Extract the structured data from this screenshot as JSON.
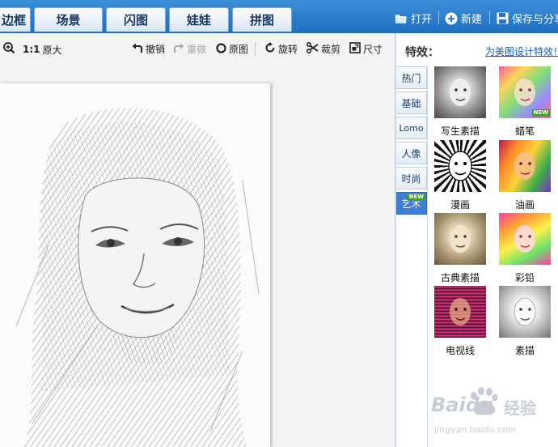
{
  "top_tabs": [
    "边框",
    "场景",
    "闪图",
    "娃娃",
    "拼图"
  ],
  "top_actions": {
    "open": "打开",
    "new": "新建",
    "save": "保存与分享"
  },
  "toolbar": {
    "zoom": "原大",
    "zoom_ratio": "1:1",
    "undo": "撤销",
    "redo": "重做",
    "original": "原图",
    "rotate": "旋转",
    "crop": "裁剪",
    "size": "尺寸"
  },
  "panel": {
    "title": "特效：",
    "link": "为美图设计特效！",
    "categories": [
      "热门",
      "基础",
      "Lomo",
      "人像",
      "时尚",
      "艺术"
    ],
    "active_category": "艺术",
    "new_badge": "NEW",
    "effects": [
      "写生素描",
      "蜡笔",
      "漫画",
      "油画",
      "古典素描",
      "彩铅",
      "电视线",
      "素描"
    ]
  },
  "watermark": {
    "brand": "Baidu",
    "cn": "经验",
    "url": "jingyan.baidu.com"
  }
}
